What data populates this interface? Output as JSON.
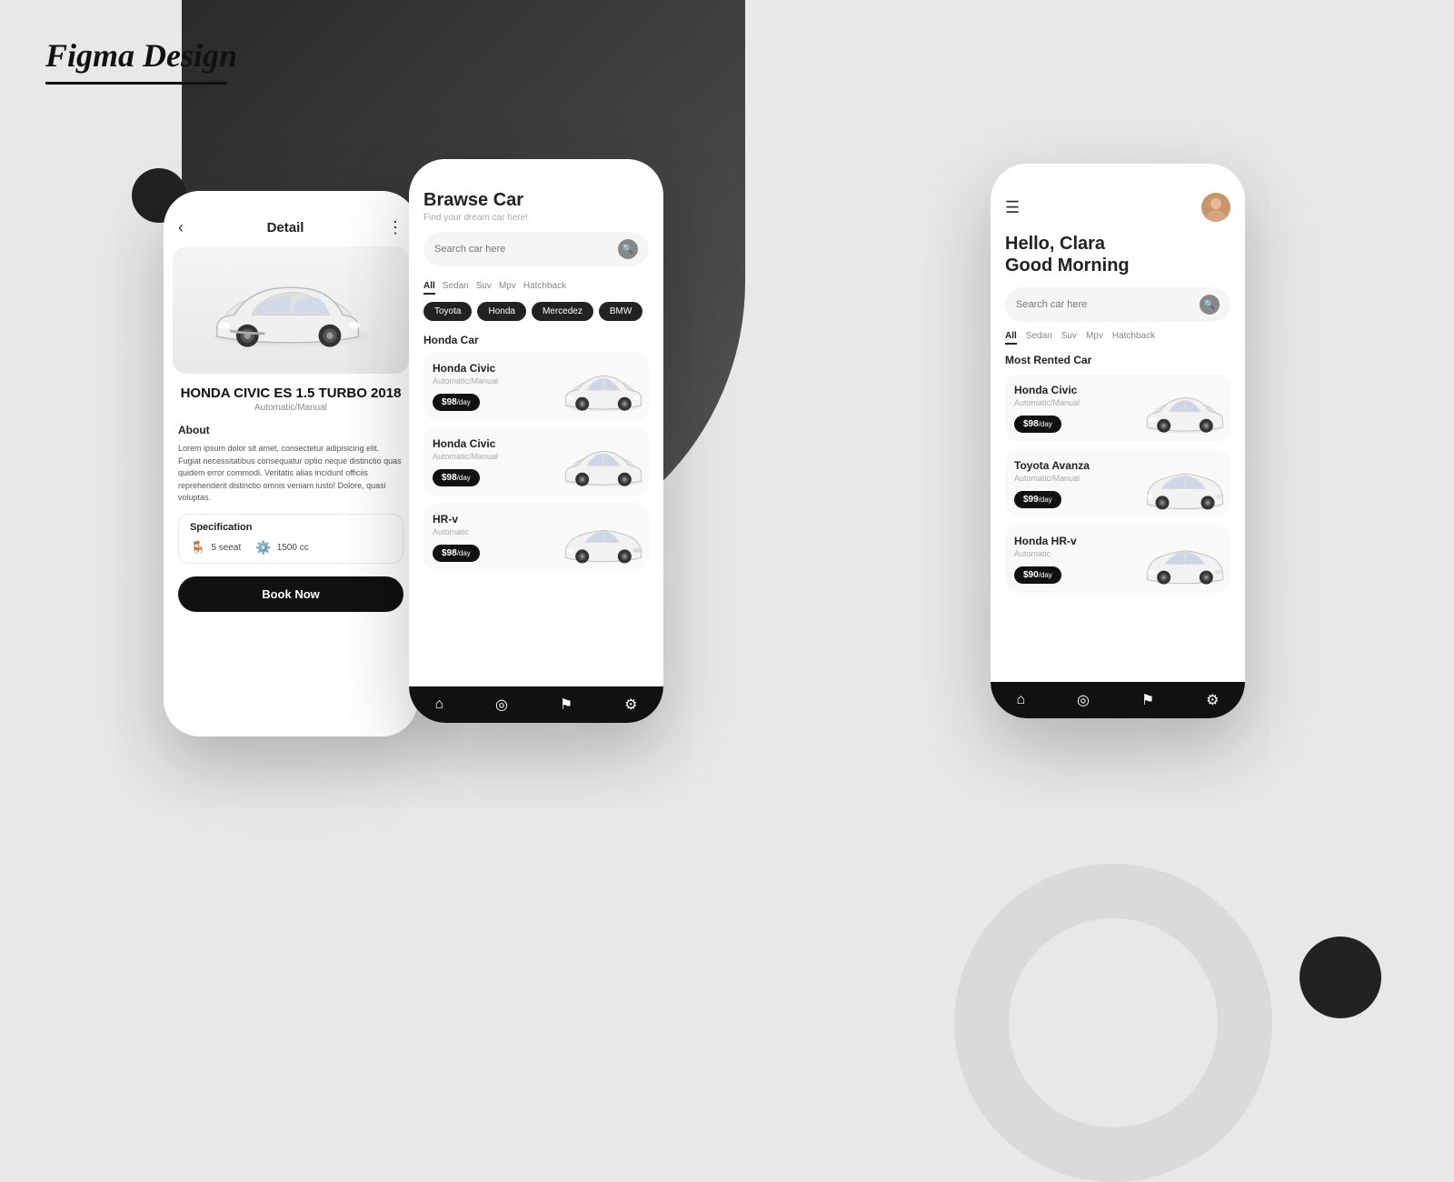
{
  "logo": {
    "text": "Figma Design"
  },
  "detail_screen": {
    "title": "Detail",
    "car_name": "HONDA CIVIC ES 1.5 TURBO 2018",
    "car_subtitle": "Automatic/Manual",
    "about_title": "About",
    "description": "Lorem ipsum dolor sit amet, consectetur adipisicing elit. Fugiat necessitatibus consequatur optio neque distinctio quas quidem error commodi. Veritatis alias incidunt officiis reprehenderit distinctio omnis veniam iusto! Dolore, quasi voluptas.",
    "spec_title": "Specification",
    "spec_seat": "5 seeat",
    "spec_cc": "1500 cc",
    "book_btn": "Book Now"
  },
  "browse_screen": {
    "title": "Brawse Car",
    "subtitle": "Find your dream car here!",
    "search_placeholder": "Search car here",
    "filters": [
      "All",
      "Sedan",
      "Suv",
      "Mpv",
      "Hatchback"
    ],
    "active_filter": "All",
    "brands": [
      "Toyota",
      "Honda",
      "Mercedez",
      "BMW"
    ],
    "section_title": "Honda Car",
    "cars": [
      {
        "name": "Honda Civic",
        "sub": "Automatic/Manual",
        "price": "$98",
        "unit": "/day"
      },
      {
        "name": "Honda Civic",
        "sub": "Automatic/Manual",
        "price": "$98",
        "unit": "/day"
      },
      {
        "name": "HR-v",
        "sub": "Automatic",
        "price": "$98",
        "unit": "/day"
      }
    ]
  },
  "home_screen": {
    "greeting_line1": "Hello, Clara",
    "greeting_line2": "Good Morning",
    "search_placeholder": "Search car here",
    "filters": [
      "All",
      "Sedan",
      "Suv",
      "Mpv",
      "Hatchback"
    ],
    "most_rented_title": "Most Rented Car",
    "cars": [
      {
        "name": "Honda Civic",
        "sub": "Automatic/Manual",
        "price": "$98",
        "unit": "/day"
      },
      {
        "name": "Toyota Avanza",
        "sub": "Automatic/Manual",
        "price": "$99",
        "unit": "/day"
      },
      {
        "name": "Honda HR-v",
        "sub": "Automatic",
        "price": "$90",
        "unit": "/day"
      }
    ]
  },
  "nav": {
    "icons": [
      "home",
      "compass",
      "bookmark",
      "settings"
    ]
  }
}
